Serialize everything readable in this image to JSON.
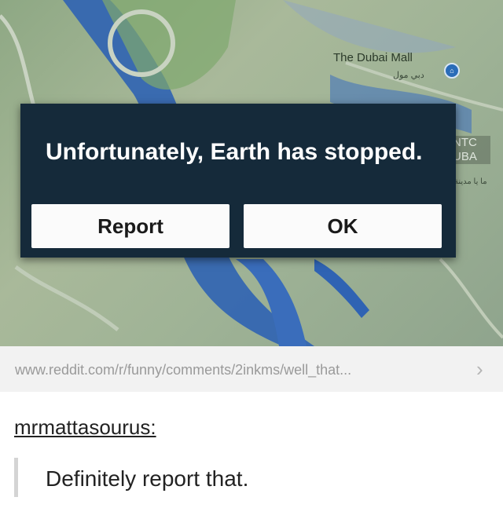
{
  "map": {
    "place_label": "The Dubai Mall",
    "place_label_ar": "دبي مول",
    "side_tag": "NTC UBA",
    "side_tag_ar": "ما يا مدينة"
  },
  "dialog": {
    "message": "Unfortunately, Earth has stopped.",
    "report_label": "Report",
    "ok_label": "OK"
  },
  "link": {
    "url": "www.reddit.com/r/funny/comments/2inkms/well_that...",
    "chevron": "›"
  },
  "post": {
    "username": "mrmattasourus:",
    "reply": "Definitely report that."
  },
  "colors": {
    "dialog_bg": "#152a3a",
    "button_bg": "#fbfbfb",
    "water": "#2f63b3"
  }
}
